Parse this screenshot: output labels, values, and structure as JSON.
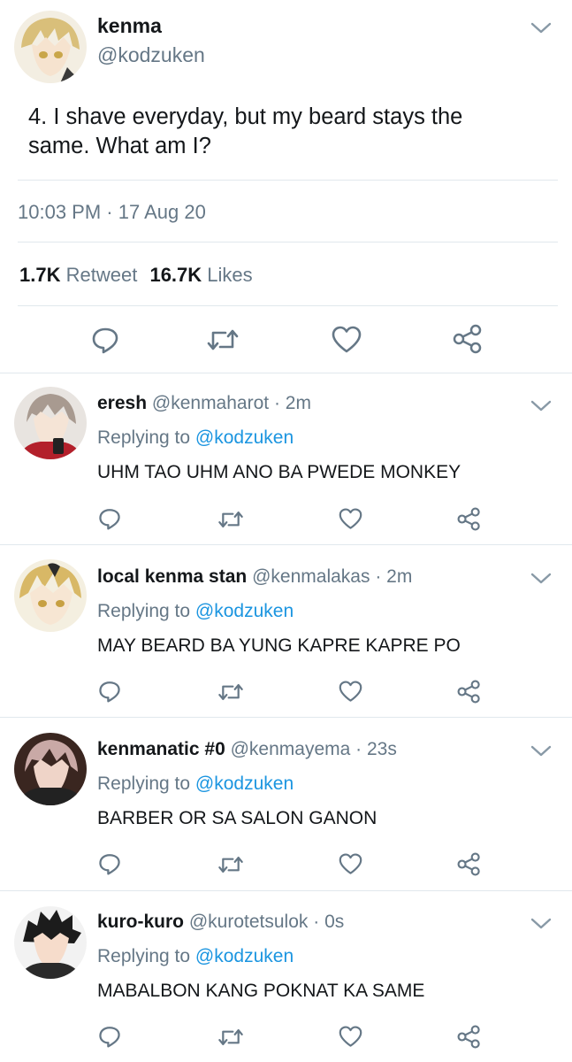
{
  "main_tweet": {
    "display_name": "kenma",
    "handle": "@kodzuken",
    "text_line1": "4. I shave everyday, but my beard stays the",
    "text_line2": "same. What am I?",
    "timestamp": "10:03 PM · 17 Aug 20",
    "retweet_count": "1.7K",
    "retweet_label": "Retweet",
    "likes_count": "16.7K",
    "likes_label": "Likes"
  },
  "replying_label": "Replying to",
  "replies": [
    {
      "display_name": "eresh",
      "handle": "@kenmaharot",
      "time": "· 2m",
      "replying_to": "@kodzuken",
      "text": "UHM TAO UHM ANO BA PWEDE MONKEY"
    },
    {
      "display_name": "local kenma stan",
      "handle": "@kenmalakas",
      "time": "· 2m",
      "replying_to": "@kodzuken",
      "text": "MAY BEARD BA YUNG KAPRE KAPRE PO"
    },
    {
      "display_name": "kenmanatic #0",
      "handle": "@kenmayema",
      "time": "· 23s",
      "replying_to": "@kodzuken",
      "text": "BARBER OR SA SALON GANON"
    },
    {
      "display_name": "kuro-kuro",
      "handle": "@kurotetsulok",
      "time": "· 0s",
      "replying_to": "@kodzuken",
      "text": "MABALBON KANG POKNAT KA SAME"
    }
  ],
  "colors": {
    "text": "#14171a",
    "muted": "#657786",
    "link": "#1b95e0",
    "divider": "#e1e8ed"
  },
  "icons": [
    "chevron-down-icon",
    "reply-icon",
    "retweet-icon",
    "like-icon",
    "share-icon"
  ]
}
